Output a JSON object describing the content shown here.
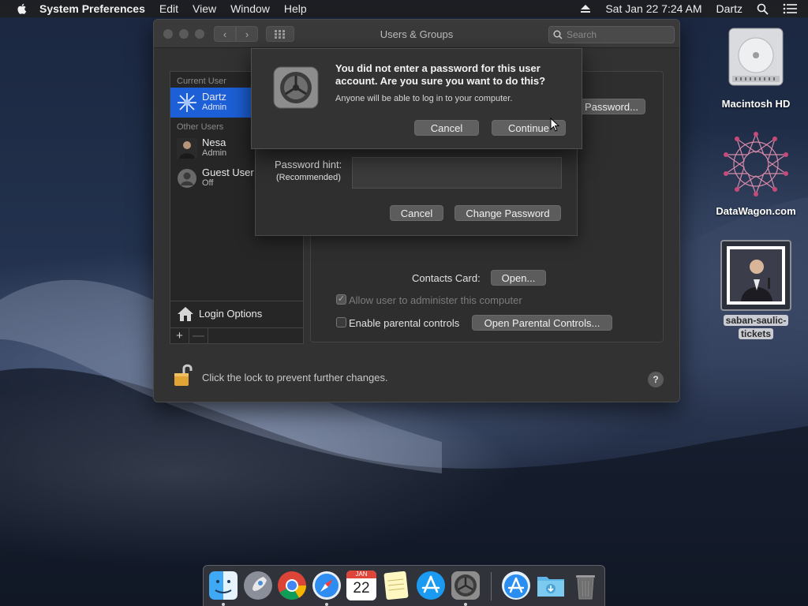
{
  "menubar": {
    "app_name": "System Preferences",
    "menus": [
      "Edit",
      "View",
      "Window",
      "Help"
    ],
    "datetime": "Sat Jan 22  7:24 AM",
    "user": "Dartz"
  },
  "window": {
    "title": "Users & Groups",
    "search_placeholder": "Search"
  },
  "sidebar": {
    "current_users_header": "Current User",
    "other_users_header": "Other Users",
    "users": [
      {
        "name": "Dartz",
        "role": "Admin"
      },
      {
        "name": "Nesa",
        "role": "Admin"
      },
      {
        "name": "Guest User",
        "role": "Off"
      }
    ],
    "login_options": "Login Options",
    "add": "+",
    "remove": "—"
  },
  "pane": {
    "change_password_btn": "Password...",
    "contacts_label": "Contacts Card:",
    "open_btn": "Open...",
    "allow_admin": "Allow user to administer this computer",
    "parental_controls": "Enable parental controls",
    "open_parental_btn": "Open Parental Controls..."
  },
  "lock": {
    "text": "Click the lock to prevent further changes."
  },
  "help": "?",
  "password_sheet": {
    "hint_label": "Password hint:",
    "hint_sub": "(Recommended)",
    "cancel": "Cancel",
    "change_password": "Change Password"
  },
  "alert": {
    "title": "You did not enter a password for this user account. Are you sure you want to do this?",
    "body": "Anyone will be able to log in to your computer.",
    "cancel": "Cancel",
    "continue": "Continue"
  },
  "desktop": {
    "hd_label": "Macintosh HD",
    "datawagon_label": "DataWagon.com",
    "file_label_line1": "saban-saulic-",
    "file_label_line2": "tickets"
  },
  "dock": {
    "calendar_month": "JAN",
    "calendar_day": "22"
  }
}
